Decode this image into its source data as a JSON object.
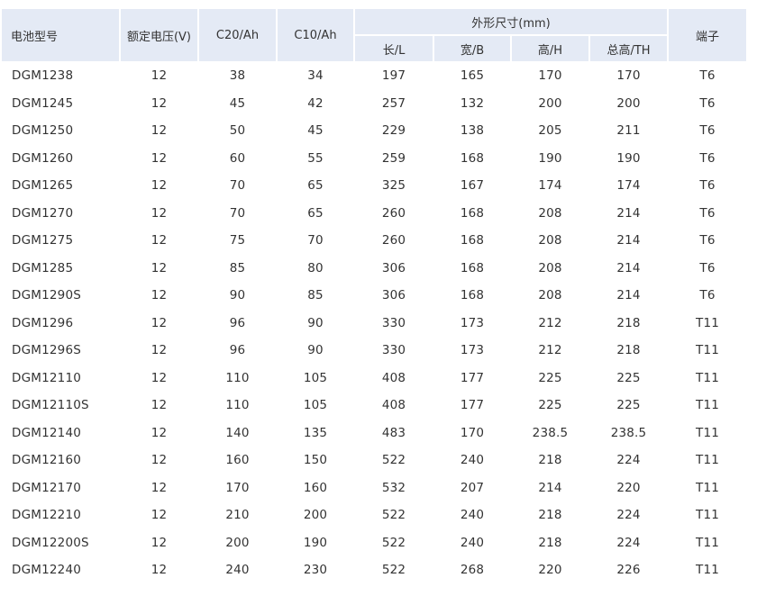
{
  "table": {
    "header": {
      "model": "电池型号",
      "voltage": "额定电压(V)",
      "c20": "C20/Ah",
      "c10": "C10/Ah",
      "dimensions": "外形尺寸(mm)",
      "length": "长/L",
      "width": "宽/B",
      "height": "高/H",
      "total_height": "总高/TH",
      "terminal": "端子"
    },
    "rows": [
      [
        "DGM1238",
        "12",
        "38",
        "34",
        "197",
        "165",
        "170",
        "170",
        "T6"
      ],
      [
        "DGM1245",
        "12",
        "45",
        "42",
        "257",
        "132",
        "200",
        "200",
        "T6"
      ],
      [
        "DGM1250",
        "12",
        "50",
        "45",
        "229",
        "138",
        "205",
        "211",
        "T6"
      ],
      [
        "DGM1260",
        "12",
        "60",
        "55",
        "259",
        "168",
        "190",
        "190",
        "T6"
      ],
      [
        "DGM1265",
        "12",
        "70",
        "65",
        "325",
        "167",
        "174",
        "174",
        "T6"
      ],
      [
        "DGM1270",
        "12",
        "70",
        "65",
        "260",
        "168",
        "208",
        "214",
        "T6"
      ],
      [
        "DGM1275",
        "12",
        "75",
        "70",
        "260",
        "168",
        "208",
        "214",
        "T6"
      ],
      [
        "DGM1285",
        "12",
        "85",
        "80",
        "306",
        "168",
        "208",
        "214",
        "T6"
      ],
      [
        "DGM1290S",
        "12",
        "90",
        "85",
        "306",
        "168",
        "208",
        "214",
        "T6"
      ],
      [
        "DGM1296",
        "12",
        "96",
        "90",
        "330",
        "173",
        "212",
        "218",
        "T11"
      ],
      [
        "DGM1296S",
        "12",
        "96",
        "90",
        "330",
        "173",
        "212",
        "218",
        "T11"
      ],
      [
        "DGM12110",
        "12",
        "110",
        "105",
        "408",
        "177",
        "225",
        "225",
        "T11"
      ],
      [
        "DGM12110S",
        "12",
        "110",
        "105",
        "408",
        "177",
        "225",
        "225",
        "T11"
      ],
      [
        "DGM12140",
        "12",
        "140",
        "135",
        "483",
        "170",
        "238.5",
        "238.5",
        "T11"
      ],
      [
        "DGM12160",
        "12",
        "160",
        "150",
        "522",
        "240",
        "218",
        "224",
        "T11"
      ],
      [
        "DGM12170",
        "12",
        "170",
        "160",
        "532",
        "207",
        "214",
        "220",
        "T11"
      ],
      [
        "DGM12210",
        "12",
        "210",
        "200",
        "522",
        "240",
        "218",
        "224",
        "T11"
      ],
      [
        "DGM12200S",
        "12",
        "200",
        "190",
        "522",
        "240",
        "218",
        "224",
        "T11"
      ],
      [
        "DGM12240",
        "12",
        "240",
        "230",
        "522",
        "268",
        "220",
        "226",
        "T11"
      ]
    ]
  }
}
